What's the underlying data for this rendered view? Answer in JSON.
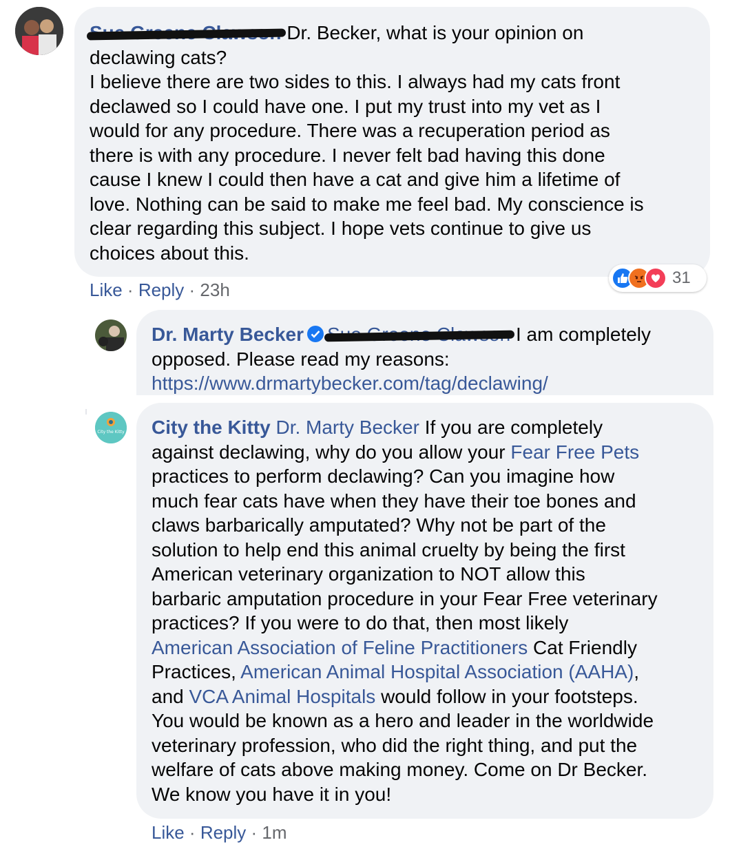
{
  "comments": [
    {
      "author": "Sue Greene Clawson",
      "body_lines": [
        " Dr. Becker, what is your opinion on",
        "declawing cats?",
        "I believe there are two sides to this. I always had my cats front",
        "declawed so I could have one. I put my trust into my vet as I",
        "would for any procedure. There was a recuperation period as",
        "there is with any procedure. I never felt bad having this done",
        "cause I knew I could then have a cat and give him a lifetime of",
        "love. Nothing can be said to make me feel bad. My conscience is",
        "clear regarding this subject. I hope vets continue to give us",
        "choices about this."
      ],
      "actions": {
        "like": "Like",
        "sep": " · ",
        "reply": "Reply",
        "time": "23h"
      },
      "reactions": {
        "count": "31",
        "icons": [
          "like-icon",
          "angry-icon",
          "love-icon"
        ]
      }
    },
    {
      "author": "Dr. Marty Becker",
      "tagged": "Sue Greene Clawson",
      "body_first": " I am completely",
      "body_line2": "opposed. Please read my reasons:",
      "link": "https://www.drmartybecker.com/tag/declawing/"
    },
    {
      "author": "City the Kitty",
      "tagged": "Dr. Marty Becker",
      "line1_rest": " If you are completely",
      "line2_a": "against declawing, why do you allow your ",
      "line2_link": "Fear Free Pets",
      "lines_mid": [
        "practices to perform declawing? Can you imagine how",
        "much fear cats have when they have their toe bones and",
        "claws barbarically amputated? Why not be part of the",
        "solution to help end this animal cruelty by being the first",
        "American veterinary organization to NOT allow this",
        "barbaric amputation procedure in your Fear Free veterinary",
        "practices? If you were to do that, then most likely"
      ],
      "line10_link": "American Association of Feline Practitioners",
      "line10_rest": " Cat Friendly",
      "line11_a": "Practices, ",
      "line11_link": "American Animal Hospital Association (AAHA)",
      "line11_rest": ",",
      "line12_a": "and ",
      "line12_link": "VCA Animal Hospitals",
      "line12_rest": " would follow in your footsteps.",
      "lines_end": [
        "You would be known as a hero and leader in the worldwide",
        "veterinary profession, who did the right thing, and put the",
        "welfare of cats above making money. Come on Dr Becker.",
        "We know you have it in you!"
      ],
      "avatar_text": "City the Kitty",
      "actions": {
        "like": "Like",
        "sep": " · ",
        "reply": "Reply",
        "time": "1m"
      }
    }
  ],
  "colors": {
    "bubble": "#f0f2f5",
    "link": "#385898",
    "meta": "#65676b"
  }
}
